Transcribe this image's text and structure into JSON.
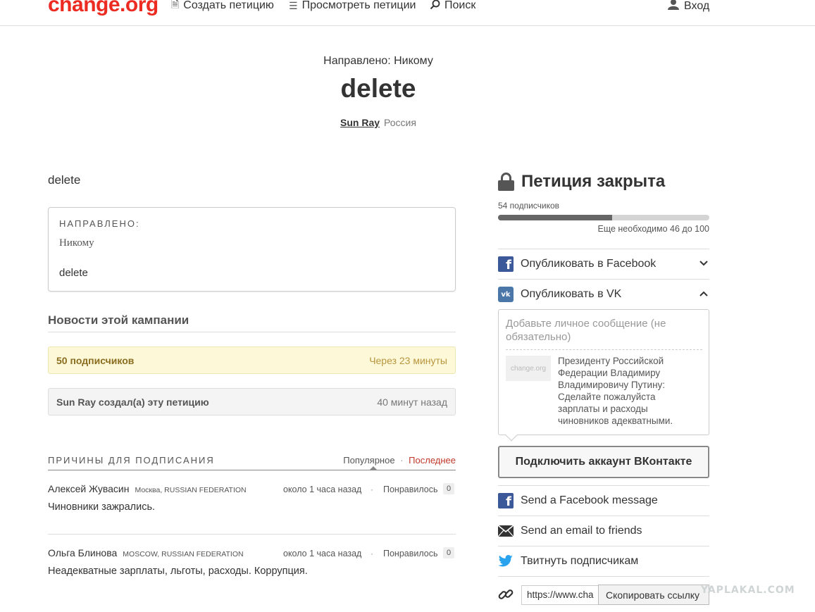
{
  "header": {
    "logo": "change.org",
    "nav": [
      {
        "label": "Создать петицию",
        "icon": "document-icon"
      },
      {
        "label": "Просмотреть петиции",
        "icon": "list-icon"
      },
      {
        "label": "Поиск",
        "icon": "search-icon"
      }
    ],
    "login_label": "Вход"
  },
  "petition": {
    "directed_to": "Направлено: Никому",
    "title": "delete",
    "author": "Sun Ray",
    "country": "Россия",
    "description": "delete",
    "card": {
      "label": "НАПРАВЛЕНО:",
      "recipient": "Никому",
      "body": "delete"
    }
  },
  "news": {
    "heading": "Новости этой кампании",
    "updates": [
      {
        "text": "50 подписчиков",
        "date": "Через 23 минуты"
      },
      {
        "text": "Sun Ray создал(а) эту петицию",
        "date": "40 минут назад"
      }
    ]
  },
  "reasons": {
    "heading": "ПРИЧИНЫ ДЛЯ ПОДПИСАНИЯ",
    "sort_popular": "Популярное",
    "sort_separator": "·",
    "sort_latest": "Последнее",
    "items": [
      {
        "name": "Алексей Жувасин",
        "location": "Москва, RUSSIAN FEDERATION",
        "time": "около 1 часа назад",
        "sep": "·",
        "like_label": "Понравилось",
        "likes": "0",
        "text": "Чиновники зажрались."
      },
      {
        "name": "Ольга Блинова",
        "location": "MOSCOW, RUSSIAN FEDERATION",
        "time": "около 1 часа назад",
        "sep": "·",
        "like_label": "Понравилось",
        "likes": "0",
        "text": "Неадекватные зарплаты, льготы, расходы. Коррупция."
      }
    ]
  },
  "sidebar": {
    "status": "Петиция закрыта",
    "signers": "54 подписчиков",
    "progress_fraction": 0.54,
    "needed": "Еще необходимо 46 до 100",
    "share_facebook": "Опубликовать в Facebook",
    "share_vk": "Опубликовать в VK",
    "vk_placeholder": "Добавьте личное сообщение (не обязательно)",
    "vk_thumb": "change.org",
    "vk_preview": "Президенту Российской Федерации Владимиру Владимировичу Путину: Сделайте пожалуйста зарплаты и расходы чиновников адекватными.",
    "vk_connect": "Подключить аккаунт ВКонтакте",
    "fb_message": "Send a Facebook message",
    "email_friends": "Send an email to friends",
    "tweet": "Твитнуть подписчикам",
    "link_value": "https://www.cha",
    "copy_label": "Скопировать ссылку"
  },
  "watermark": "YAPLAKAL.COM",
  "colors": {
    "brand": "#ec2c22",
    "facebook": "#3b5998",
    "vk": "#4a76a8",
    "twitter": "#2aa3ef",
    "update_bg": "#fdf8d8"
  }
}
